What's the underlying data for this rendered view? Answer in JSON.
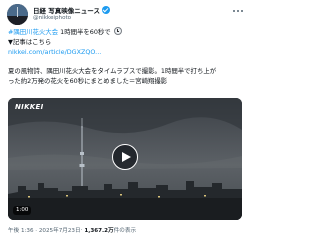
{
  "post": {
    "author": {
      "display_name": "日経 写真映像ニュース",
      "handle": "@nikkeiphoto",
      "verified": true,
      "avatar_icon": "avatar-tokyo-skytree",
      "more_icon": "more-options-icon"
    },
    "hashtag": "#隅田川花火大会",
    "line1_rest": " 1時間半を60秒で",
    "clock_icon": "clock-emoji",
    "line2": "▼記事はこちら",
    "link": "nikkei.com/article/DGXZQO...",
    "body_line1": "夏の風物詩、隅田川花火大会をタイムラプスで撮影。1時間半で打ち上が",
    "body_line2": "った約2万発の花火を60秒にまとめました＝宮崎翔撮影",
    "body_line3": "",
    "media": {
      "type": "video",
      "brand": "NIKKEI",
      "duration": "1:00",
      "play_icon": "play-icon"
    },
    "time": "午後 1:36 · 2025年7月23日",
    "separator": " · ",
    "views_count": "1,367.2万",
    "views_label": "件の表示"
  },
  "colors": {
    "link": "#1d9bf0",
    "text": "#0f1419",
    "muted": "#536471",
    "verified": "#1d9bf0"
  }
}
